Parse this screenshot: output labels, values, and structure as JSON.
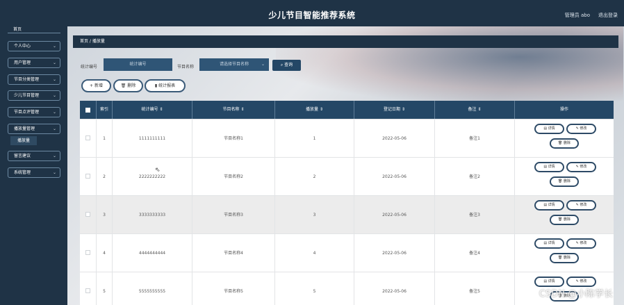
{
  "header": {
    "title": "少儿节目智能推荐系统",
    "admin": "管理员 abo",
    "logout": "退出登录"
  },
  "sidebar": {
    "home": "首页",
    "items": [
      {
        "label": "个人中心"
      },
      {
        "label": "用户管理"
      },
      {
        "label": "节目分类管理"
      },
      {
        "label": "少儿节目管理"
      },
      {
        "label": "节目点评管理"
      },
      {
        "label": "播放量管理"
      },
      {
        "label": "留言建议"
      },
      {
        "label": "系统管理"
      }
    ],
    "active_sub": "播放量"
  },
  "breadcrumb": "首页 / 播放量",
  "search": {
    "label1": "统计编号",
    "placeholder1": "统计编号",
    "label2": "节目名称",
    "placeholder2": "请选择节目名称",
    "button": "查询"
  },
  "actions": {
    "add": "新增",
    "delete": "删除",
    "report": "统计报表"
  },
  "table": {
    "headers": [
      "索引",
      "统计编号 ⇕",
      "节目名称 ⇕",
      "播放量 ⇕",
      "登记日期 ⇕",
      "备注 ⇕",
      "操作"
    ],
    "rows": [
      {
        "index": "1",
        "code": "1111111111",
        "name": "节目名称1",
        "plays": "1",
        "date": "2022-05-06",
        "note": "备注1"
      },
      {
        "index": "2",
        "code": "2222222222",
        "name": "节目名称2",
        "plays": "2",
        "date": "2022-05-06",
        "note": "备注2"
      },
      {
        "index": "3",
        "code": "3333333333",
        "name": "节目名称3",
        "plays": "3",
        "date": "2022-05-06",
        "note": "备注3"
      },
      {
        "index": "4",
        "code": "4444444444",
        "name": "节目名称4",
        "plays": "4",
        "date": "2022-05-06",
        "note": "备注4"
      },
      {
        "index": "5",
        "code": "5555555555",
        "name": "节目名称5",
        "plays": "5",
        "date": "2022-05-06",
        "note": "备注5"
      }
    ],
    "op_detail": "详情",
    "op_edit": "修改",
    "op_delete": "删除"
  },
  "watermark": "CSDN @小陈学长",
  "icons": {
    "chevron": "chevron-down-icon",
    "search": "search-icon",
    "add": "plus-icon",
    "delete": "trash-icon",
    "report": "bar-chart-icon",
    "detail": "document-icon",
    "edit": "pencil-icon"
  }
}
